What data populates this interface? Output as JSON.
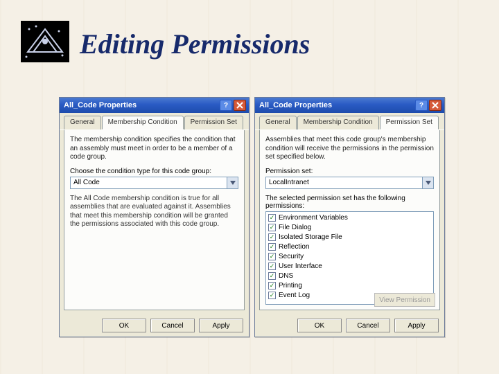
{
  "slide": {
    "title": "Editing Permissions"
  },
  "dialog_left": {
    "title": "All_Code Properties",
    "tabs": {
      "general": "General",
      "membership": "Membership Condition",
      "permission_set": "Permission Set"
    },
    "desc": "The membership condition specifies the condition that an assembly must meet in order to be a member of a code group.",
    "cond_label": "Choose the condition type for this code group:",
    "cond_value": "All Code",
    "cond_hint": "The All Code membership condition is true for all assemblies that are evaluated against it. Assemblies that meet this membership condition will be granted the permissions associated with this code group.",
    "ok": "OK",
    "cancel": "Cancel",
    "apply": "Apply"
  },
  "dialog_right": {
    "title": "All_Code Properties",
    "tabs": {
      "general": "General",
      "membership": "Membership Condition",
      "permission_set": "Permission Set"
    },
    "desc": "Assemblies that meet this code group's membership condition will receive the permissions in the permission set specified below.",
    "perm_label": "Permission set:",
    "perm_value": "LocalIntranet",
    "list_label": "The selected permission set has the following permissions:",
    "items": [
      "Environment Variables",
      "File Dialog",
      "Isolated Storage File",
      "Reflection",
      "Security",
      "User Interface",
      "DNS",
      "Printing",
      "Event Log"
    ],
    "view_btn": "View Permission",
    "ok": "OK",
    "cancel": "Cancel",
    "apply": "Apply"
  }
}
